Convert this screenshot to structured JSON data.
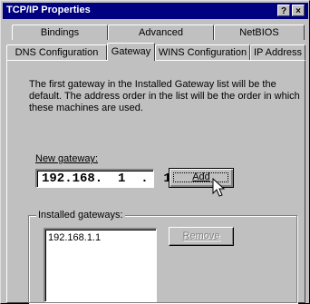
{
  "window": {
    "title": "TCP/IP Properties",
    "help_button": "?",
    "close_button": "×"
  },
  "tabs": {
    "row1": [
      {
        "label": "Bindings"
      },
      {
        "label": "Advanced"
      },
      {
        "label": "NetBIOS"
      }
    ],
    "row2": [
      {
        "label": "DNS Configuration"
      },
      {
        "label": "Gateway",
        "active": true
      },
      {
        "label": "WINS Configuration"
      },
      {
        "label": "IP Address"
      }
    ]
  },
  "gateway": {
    "description": "The first gateway in the Installed Gateway list will be the default. The address order in the list will be the order in which these machines are used.",
    "new_gateway_label": "New gateway:",
    "new_gateway_value": "192.168.  1  .  1",
    "add_button": "Add",
    "installed_label": "Installed gateways:",
    "installed_list": [
      "192.168.1.1"
    ],
    "remove_button": "Remove"
  },
  "colors": {
    "titlebar": "#000080",
    "face": "#c0c0c0"
  }
}
